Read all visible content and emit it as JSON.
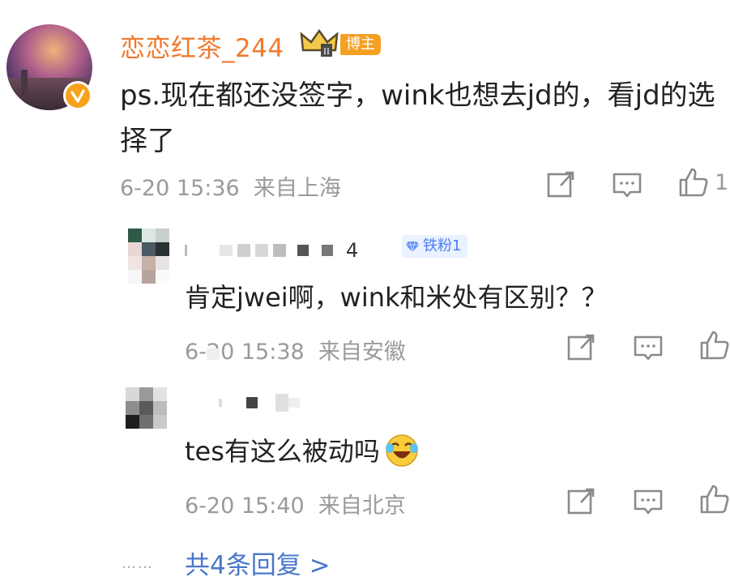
{
  "comment": {
    "username": "恋恋红茶_244",
    "role_badge": "博主",
    "text": "ps.现在都还没签字，wink也想去jd的，看jd的选择了",
    "time": "6-20 15:36",
    "location": "来自上海",
    "like_count": "1"
  },
  "replies": [
    {
      "username_masked": "4",
      "badge": "铁粉1",
      "text": "肯定jwei啊，wink和米处有区别？？",
      "time": "6-20 15:38",
      "location": "来自安徽"
    },
    {
      "text": "tes有这么被动吗",
      "time": "6-20 15:40",
      "location": "来自北京"
    }
  ],
  "more_replies_label": "共4条回复 >",
  "icons": [
    "share-icon",
    "comment-icon",
    "like-icon",
    "verified-icon",
    "crown-icon",
    "diamond-icon",
    "laughing-emoji-icon"
  ],
  "colors": {
    "username": "#f07a2e",
    "badge": "#f4a023",
    "link": "#4a78c9"
  }
}
